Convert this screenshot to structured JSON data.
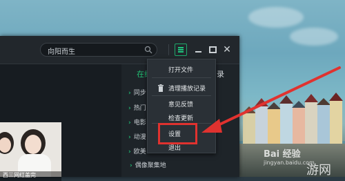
{
  "search": {
    "value": "向阳而生"
  },
  "header": {
    "online_title": "在线",
    "list_title_tail": "录"
  },
  "categories": [
    "同步",
    "热门",
    "电影",
    "动漫",
    "欧美"
  ],
  "bottom_category": "偶像聚集地",
  "menu": {
    "open_file": "打开文件",
    "clear_history": "清理播放记录",
    "feedback": "意见反馈",
    "check_update": "检查更新",
    "settings": "设置",
    "exit": "退出"
  },
  "photo_caption": "西三网红盖完",
  "watermark": {
    "main": "Bai 经验",
    "sub": "jingyan.baidu.com",
    "site": "游网"
  },
  "colors": {
    "accent": "#1ec47c",
    "highlight": "#e0322f"
  },
  "icons": [
    "search-icon",
    "menu-icon",
    "minimize-icon",
    "maximize-icon",
    "close-icon",
    "trash-icon",
    "chevron-right-icon"
  ]
}
